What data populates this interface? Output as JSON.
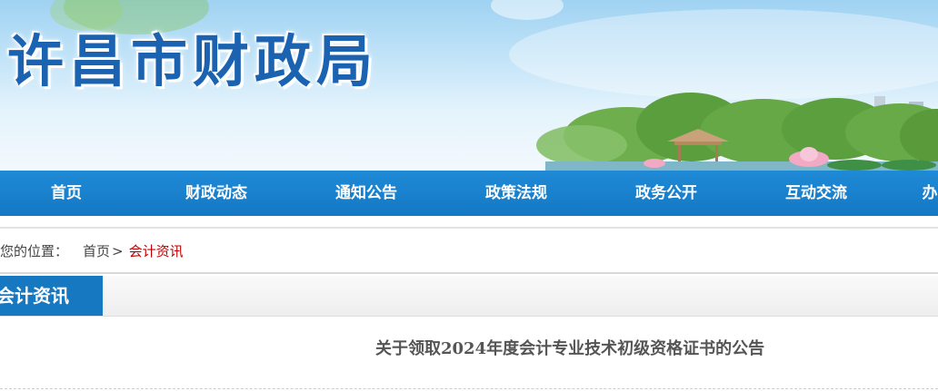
{
  "header": {
    "site_title": "许昌市财政局"
  },
  "nav": {
    "items": [
      {
        "label": "首页"
      },
      {
        "label": "财政动态"
      },
      {
        "label": "通知公告"
      },
      {
        "label": "政策法规"
      },
      {
        "label": "政务公开"
      },
      {
        "label": "互动交流"
      },
      {
        "label": "办"
      }
    ]
  },
  "breadcrumb": {
    "prefix": "您的位置：",
    "home": "首页",
    "separator": ">",
    "current": "会计资讯"
  },
  "section": {
    "title": "会计资讯"
  },
  "article": {
    "title": "关于领取2024年度会计专业技术初级资格证书的公告"
  },
  "colors": {
    "nav_blue": "#1778c2",
    "title_blue": "#1b63b0",
    "current_red": "#c00000"
  }
}
